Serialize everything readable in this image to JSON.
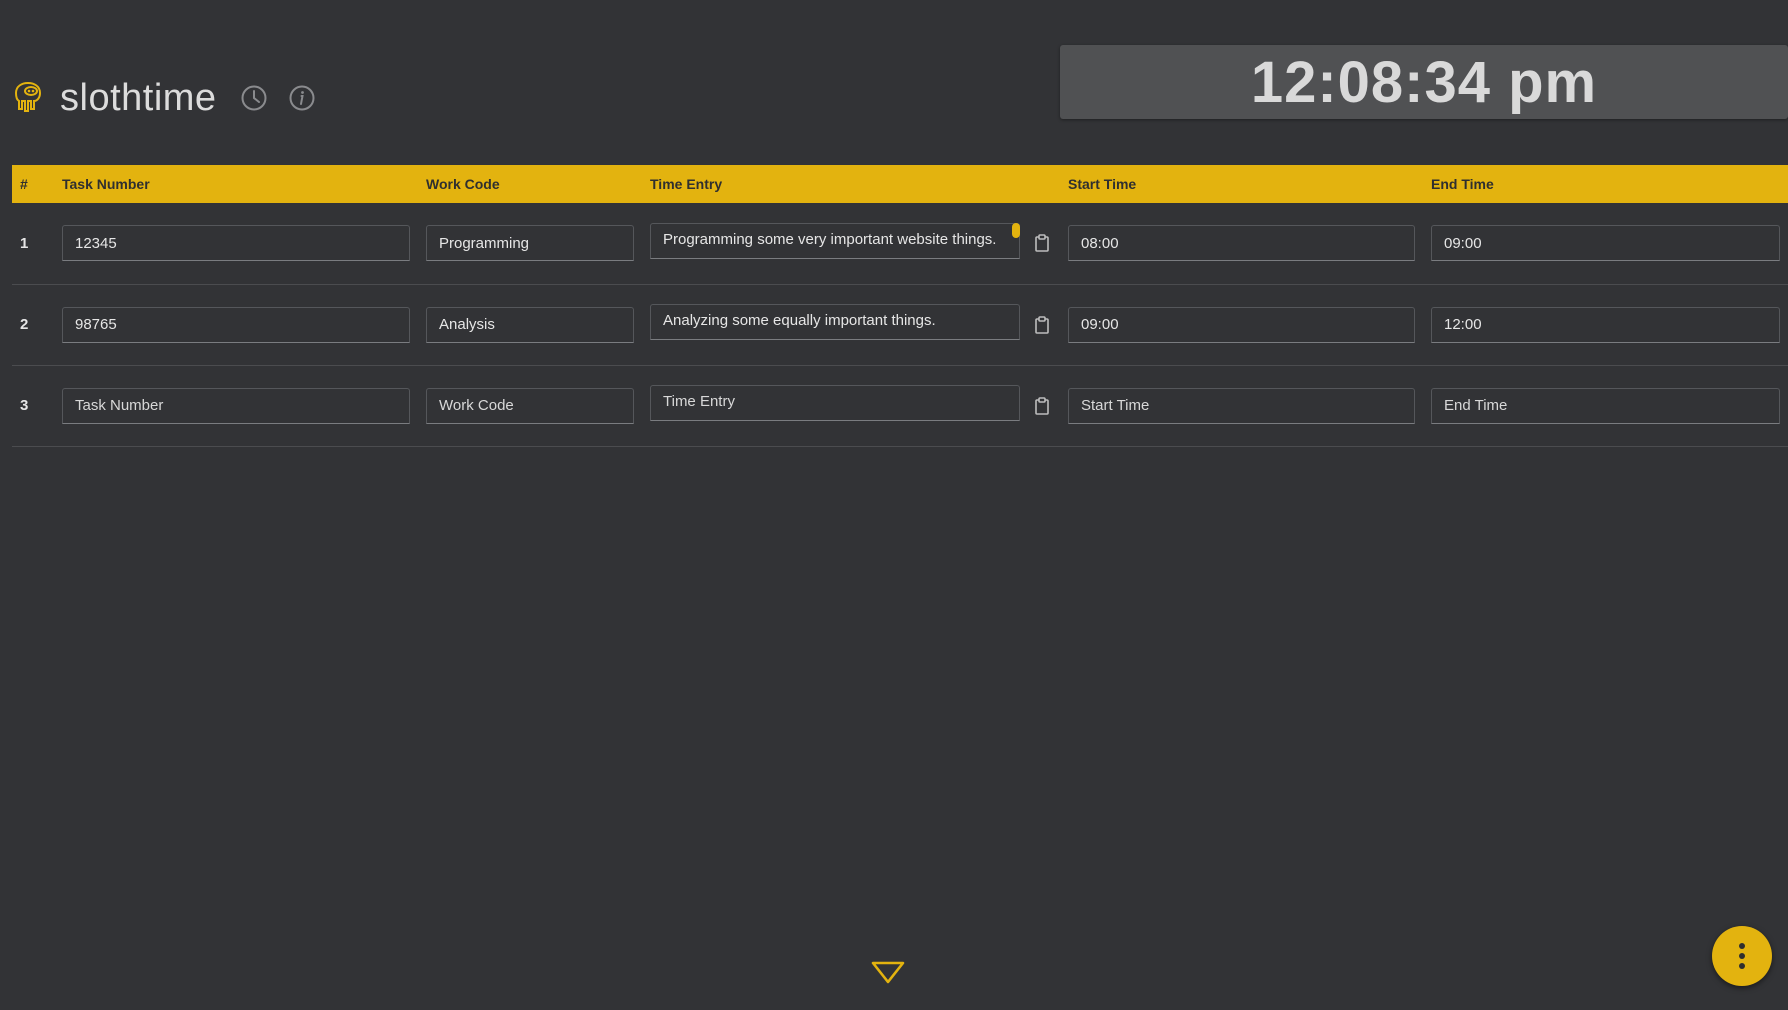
{
  "app": {
    "title": "slothtime",
    "logo_icon": "sloth-logo-icon",
    "accent_color": "#e3b30f",
    "background_color": "#323336"
  },
  "header": {
    "history_icon": "clock-icon",
    "info_icon": "info-icon"
  },
  "clock": {
    "time": "12:08:34 pm"
  },
  "table": {
    "columns": [
      "#",
      "Task Number",
      "Work Code",
      "Time Entry",
      "Start Time",
      "End Time"
    ],
    "placeholders": {
      "task_number": "Task Number",
      "work_code": "Work Code",
      "time_entry": "Time Entry",
      "start_time": "Start Time",
      "end_time": "End Time"
    },
    "rows": [
      {
        "num": "1",
        "task_number": "12345",
        "work_code": "Programming",
        "time_entry": "Programming some very important website things.",
        "start_time": "08:00",
        "end_time": "09:00"
      },
      {
        "num": "2",
        "task_number": "98765",
        "work_code": "Analysis",
        "time_entry": "Analyzing some equally important things.",
        "start_time": "09:00",
        "end_time": "12:00"
      },
      {
        "num": "3",
        "task_number": "",
        "work_code": "",
        "time_entry": "",
        "start_time": "",
        "end_time": ""
      }
    ]
  },
  "controls": {
    "copy_icon": "clipboard-icon",
    "expand_icon": "triangle-down-icon",
    "menu_icon": "more-vertical-icon"
  }
}
